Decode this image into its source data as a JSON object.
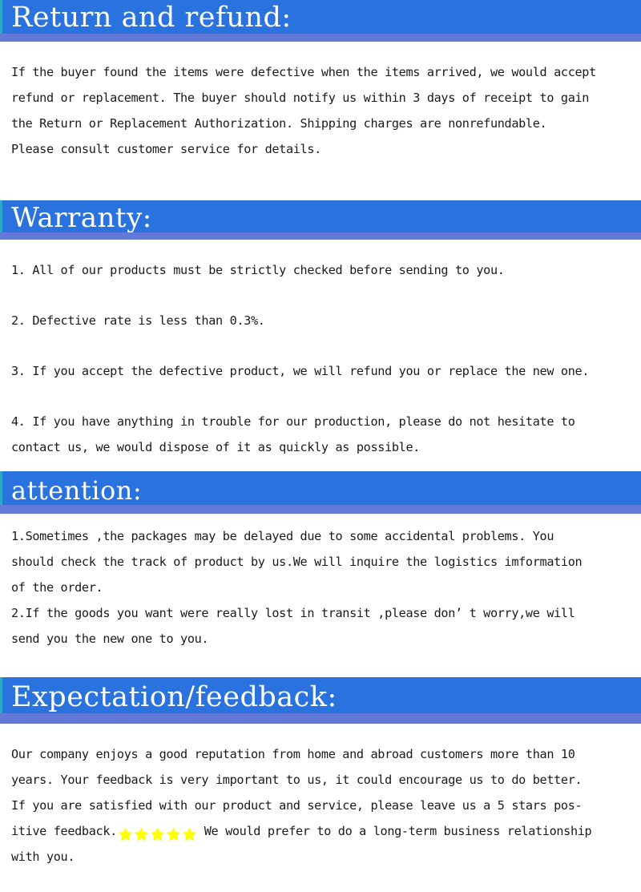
{
  "document": {
    "title": "Return and refund / Warranty / attention / Expectation-feedback policy sheet",
    "colors": {
      "band_blue": "#2a72de",
      "band_underline": "#6379d8",
      "band_edge_teal": "#2aa8c8",
      "star_yellow": "#ffff00",
      "text": "#1a1a1a",
      "background": "#ffffff"
    }
  },
  "sections": [
    {
      "id": "return-and-refund",
      "heading": "Return and refund:",
      "paragraphs": [
        "If the buyer found the items were defective when the items arrived, we would accept",
        "refund or replacement. The buyer should notify us within 3 days of receipt to gain",
        "the Return or Replacement Authorization. Shipping charges are nonrefundable.",
        "Please consult customer service for details."
      ]
    },
    {
      "id": "warranty",
      "heading": "Warranty:",
      "items": [
        "1. All of our products must be strictly checked before sending to you.",
        "2. Defective rate is less than 0.3%.",
        "3. If you accept the defective product, we will refund you or replace the new one."
      ],
      "item4": [
        "4. If you have anything in trouble for our production, please do not hesitate to",
        "contact us, we would dispose of it as quickly as possible."
      ]
    },
    {
      "id": "attention",
      "heading": "attention:",
      "item1": [
        "1.Sometimes ,the packages may be delayed due to some accidental problems. You",
        "should check the track of product by us.We will inquire the logistics imformation",
        "of the order."
      ],
      "item2": [
        "2.If the goods you want were really lost in transit ,please don’ t worry,we will",
        "send you the new one to you."
      ]
    },
    {
      "id": "expectation-feedback",
      "heading": "Expectation/feedback:",
      "lines_before_stars": [
        "Our company enjoys a good reputation from home and abroad customers more than 10",
        "years. Your feedback is very important to us, it could encourage us to do better.",
        "If you are satisfied with our product and service, please leave us a 5 stars pos-"
      ],
      "star_line_prefix": "itive feedback.",
      "star_count": 5,
      "star_line_suffix": " We would prefer to do a long-term business relationship",
      "last_line": "with you."
    }
  ]
}
